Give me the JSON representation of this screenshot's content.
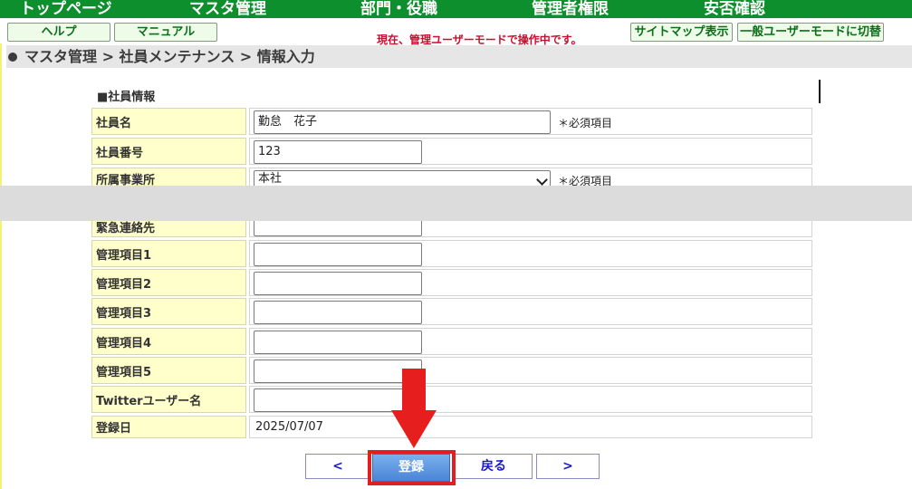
{
  "nav": {
    "items": [
      "トップページ",
      "マスタ管理",
      "部門・役職",
      "管理者権限",
      "安否確認"
    ]
  },
  "subnav": {
    "help": "ヘルプ",
    "manual": "マニュアル",
    "mode_notice": "現在、管理ユーザーモードで操作中です。",
    "sitemap": "サイトマップ表示",
    "switch_user": "一般ユーザーモードに切替"
  },
  "breadcrumb": "マスタ管理 > 社員メンテナンス > 情報入力",
  "section_title": "■社員情報",
  "form": {
    "employee_name": {
      "label": "社員名",
      "value": "勤怠　花子",
      "required": "＊必須項目"
    },
    "employee_number": {
      "label": "社員番号",
      "value": "123"
    },
    "office": {
      "label": "所属事業所",
      "selected": "本社",
      "required": "＊必須項目"
    },
    "emergency_contact": {
      "label": "緊急連絡先",
      "value": ""
    },
    "items": [
      {
        "label": "管理項目1",
        "value": ""
      },
      {
        "label": "管理項目2",
        "value": ""
      },
      {
        "label": "管理項目3",
        "value": ""
      },
      {
        "label": "管理項目4",
        "value": ""
      },
      {
        "label": "管理項目5",
        "value": ""
      }
    ],
    "twitter": {
      "label": "Twitterユーザー名",
      "value": ""
    },
    "registered_date": {
      "label": "登録日",
      "value": "2025/07/07"
    }
  },
  "buttons": {
    "prev": "<",
    "register": "登録",
    "back": "戻る",
    "next": ">"
  },
  "colors": {
    "nav_bg": "#0e8f2d",
    "label_bg": "#ffffcc",
    "highlight": "#e02020"
  }
}
